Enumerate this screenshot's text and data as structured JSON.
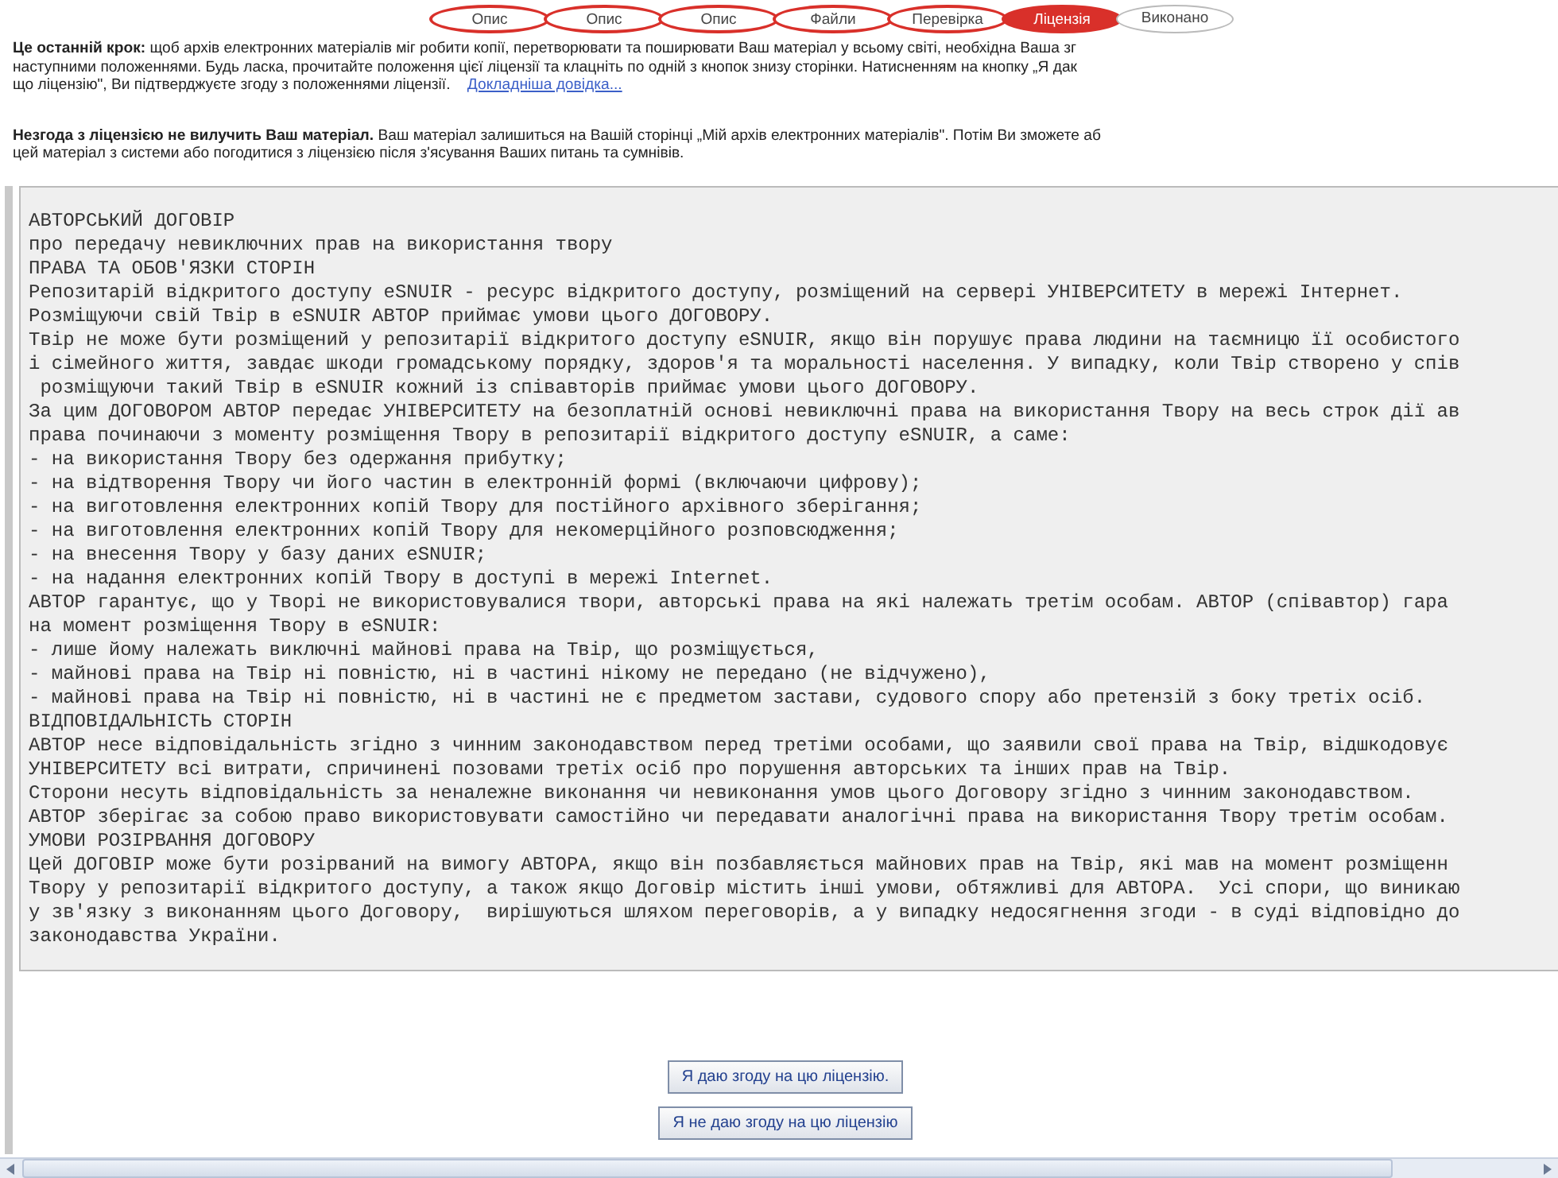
{
  "steps": [
    {
      "label": "Опис",
      "kind": "done",
      "selected": false
    },
    {
      "label": "Опис",
      "kind": "done",
      "selected": false
    },
    {
      "label": "Опис",
      "kind": "done",
      "selected": false
    },
    {
      "label": "Файли",
      "kind": "done",
      "selected": false
    },
    {
      "label": "Перевірка",
      "kind": "done",
      "selected": false
    },
    {
      "label": "Ліцензія",
      "kind": "current",
      "selected": true
    },
    {
      "label": "Виконано",
      "kind": "todo",
      "selected": false
    }
  ],
  "intro": {
    "lines": [
      "**Це останній крок:** щоб архів електронних матеріалів міг робити копії, перетворювати та поширювати Ваш матеріал у всьому світі, необхідна Ваша зг",
      "наступними положеннями. Будь ласка, прочитайте положення цієї ліцензії та клацніть по одній з кнопок знизу сторінки. Натисненням на кнопку „Я дак",
      "що ліцензію\", Ви підтверджуєте згоду з положеннями ліцензії."
    ],
    "link": "Докладніша довідка..."
  },
  "note": {
    "lines": [
      "**Незгода з ліцензією не вилучить Ваш матеріал.** Ваш матеріал залишиться на Вашій сторінці „Мій архів електронних матеріалів\". Потім Ви зможете аб",
      "цей матеріал з системи або погодитися з ліцензією після з'ясування Ваших питань та сумнівів."
    ]
  },
  "license_text": [
    "АВТОРСЬКИЙ ДОГОВІР",
    "про передачу невиключних прав на використання твору",
    "ПРАВА ТА ОБОВ'ЯЗКИ СТОРІН",
    "Репозитарій відкритого доступу eSNUIR - ресурс відкритого доступу, розміщений на сервері УНІВЕРСИТЕТУ в мережі Інтернет.",
    "Розміщуючи свій Твір в eSNUIR АВТОР приймає умови цього ДОГОВОРУ.",
    "Твір не може бути розміщений у репозитарії відкритого доступу eSNUIR, якщо він порушує права людини на таємницю її особистого",
    "і сімейного життя, завдає шкоди громадському порядку, здоров'я та моральності населення. У випадку, коли Твір створено у спів",
    " розміщуючи такий Твір в eSNUIR кожний із співавторів приймає умови цього ДОГОВОРУ.",
    "За цим ДОГОВОРОМ АВТОР передає УНІВЕРСИТЕТУ на безоплатній основі невиключні права на використання Твору на весь строк дії ав",
    "права починаючи з моменту розміщення Твору в репозитарії відкритого доступу eSNUIR, а саме:",
    "- на використання Твору без одержання прибутку;",
    "- на відтворення Твору чи його частин в електронній формі (включаючи цифрову);",
    "- на виготовлення електронних копій Твору для постійного архівного зберігання;",
    "- на виготовлення електронних копій Твору для некомерційного розповсюдження;",
    "- на внесення Твору у базу даних eSNUIR;",
    "- на надання електронних копій Твору в доступі в мережі Internet.",
    "АВТОР гарантує, що у Творі не використовувалися твори, авторські права на які належать третім особам. АВТОР (співавтор) гара",
    "на момент розміщення Твору в eSNUIR:",
    "- лише йому належать виключні майнові права на Твір, що розміщується,",
    "- майнові права на Твір ні повністю, ні в частині нікому не передано (не відчужено),",
    "- майнові права на Твір ні повністю, ні в частині не є предметом застави, судового спору або претензій з боку третіх осіб.",
    "ВІДПОВІДАЛЬНІСТЬ СТОРІН",
    "АВТОР несе відповідальність згідно з чинним законодавством перед третіми особами, що заявили свої права на Твір, відшкодовує",
    "УНІВЕРСИТЕТУ всі витрати, спричинені позовами третіх осіб про порушення авторських та інших прав на Твір.",
    "Сторони несуть відповідальність за неналежне виконання чи невиконання умов цього Договору згідно з чинним законодавством.",
    "АВТОР зберігає за собою право використовувати самостійно чи передавати аналогічні права на використання Твору третім особам.",
    "УМОВИ РОЗІРВАННЯ ДОГОВОРУ",
    "Цей ДОГОВІР може бути розірваний на вимогу АВТОРА, якщо він позбавляється майнових прав на Твір, які мав на момент розміщенн",
    "Твору у репозитарії відкритого доступу, а також якщо Договір містить інші умови, обтяжливі для АВТОРА.  Усі спори, що виникаю",
    "у зв'язку з виконанням цього Договору,  вирішуються шляхом переговорів, а у випадку недосягнення згоди - в суді відповідно до",
    "законодавства України."
  ],
  "buttons": [
    "Я даю згоду на цю ліцензію.",
    "Я не даю згоду на цю ліцензію"
  ]
}
